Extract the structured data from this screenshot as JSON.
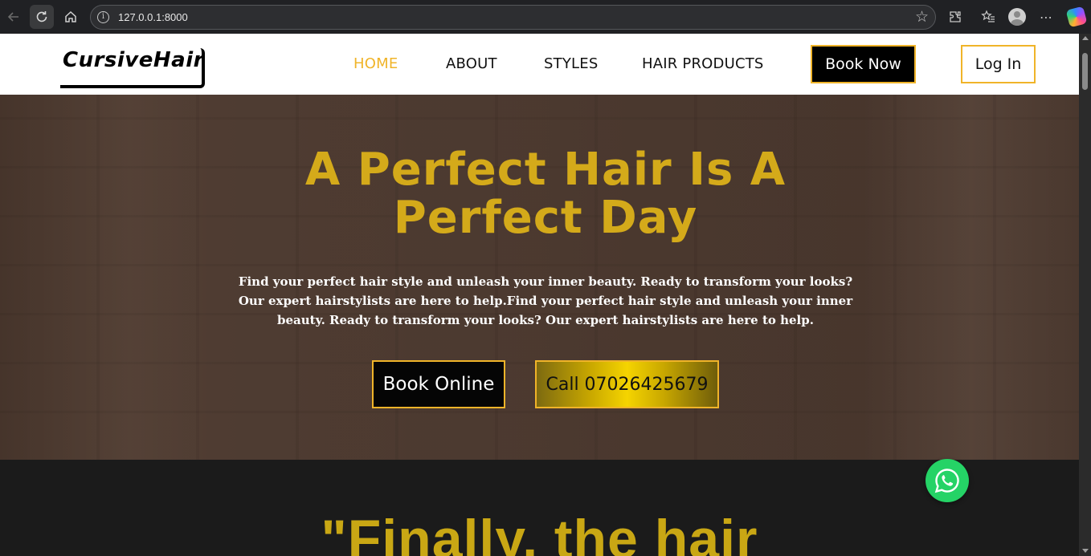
{
  "browser": {
    "url": "127.0.0.1:8000",
    "icons": [
      "back-icon",
      "reload-icon",
      "home-icon",
      "site-info-icon",
      "bookmark-star-icon",
      "extensions-icon",
      "favorites-icon",
      "profile-icon",
      "more-icon",
      "copilot-icon"
    ]
  },
  "header": {
    "logo": "CursiveHair",
    "nav": [
      {
        "label": "HOME",
        "active": true
      },
      {
        "label": "ABOUT",
        "active": false
      },
      {
        "label": "STYLES",
        "active": false
      },
      {
        "label": "HAIR PRODUCTS",
        "active": false
      }
    ],
    "book_now": "Book Now",
    "login": "Log In"
  },
  "hero": {
    "title_line1": "A Perfect Hair Is A",
    "title_line2": "Perfect Day",
    "text": "Find your perfect hair style and unleash your inner beauty. Ready to transform your looks? Our expert hairstylists are here to help.Find your perfect hair style and unleash your inner beauty. Ready to transform your looks? Our expert hairstylists are here to help.",
    "book_online": "Book Online",
    "call": "Call 07026425679"
  },
  "testimonial": {
    "heading": "\"Finally, the hair"
  },
  "colors": {
    "accent": "#f0b429",
    "title_gold": "#d4aa1a",
    "whatsapp": "#25d366"
  }
}
